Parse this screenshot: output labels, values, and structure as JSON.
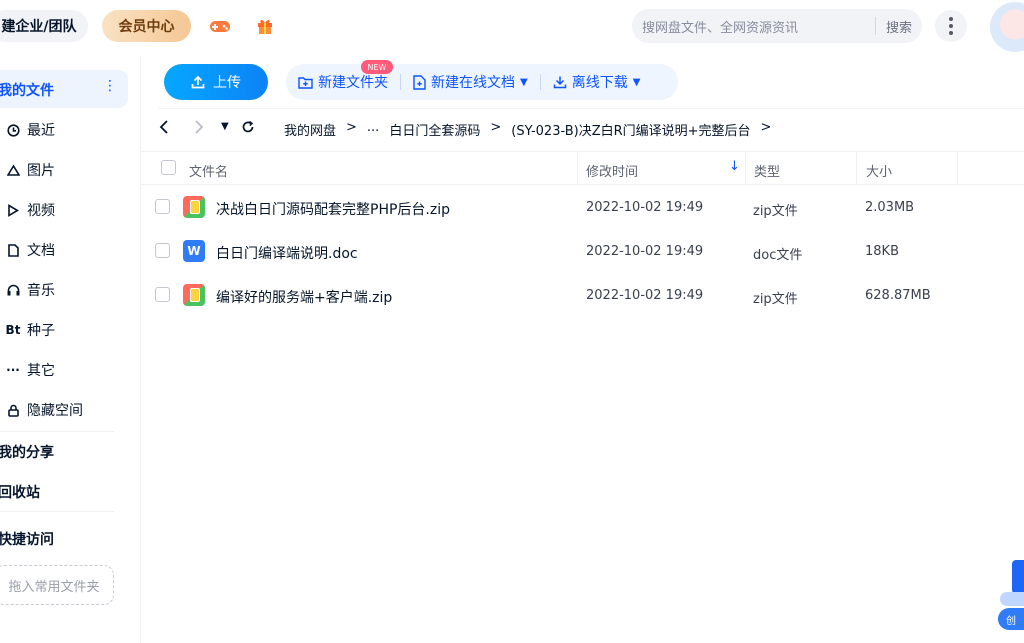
{
  "header": {
    "team_label": "建企业/团队",
    "vip_label": "会员中心",
    "search_placeholder": "搜网盘文件、全网资源资讯",
    "search_button": "搜索",
    "icons": [
      "game-icon",
      "gift-icon",
      "more-icon",
      "avatar"
    ]
  },
  "sidebar": {
    "my_files": "我的文件",
    "items": [
      {
        "icon": "clock-icon",
        "label": "最近"
      },
      {
        "icon": "image-icon",
        "label": "图片"
      },
      {
        "icon": "video-icon",
        "label": "视频"
      },
      {
        "icon": "document-icon",
        "label": "文档"
      },
      {
        "icon": "music-icon",
        "label": "音乐"
      },
      {
        "icon": "torrent-icon",
        "glyph": "Bt",
        "label": "种子"
      },
      {
        "icon": "more-dots-icon",
        "glyph": "···",
        "label": "其它"
      },
      {
        "icon": "lock-icon",
        "label": "隐藏空间"
      }
    ],
    "my_share": "我的分享",
    "recycle_bin": "回收站",
    "quick_access": "快捷访问",
    "drop_hint": "拖入常用文件夹"
  },
  "toolbar": {
    "upload": "上传",
    "new_folder": "新建文件夹",
    "new_online_doc": "新建在线文档",
    "new_badge": "NEW",
    "offline_download": "离线下载"
  },
  "breadcrumb": {
    "root": "我的网盘",
    "ellipsis": "...",
    "level1": "白日门全套源码",
    "level2": "(SY-023-B)决Z白R门编译说明+完整后台"
  },
  "table": {
    "headers": {
      "name": "文件名",
      "modified": "修改时间",
      "type": "类型",
      "size": "大小"
    },
    "rows": [
      {
        "icon": "zip-icon",
        "name": "决战白日门源码配套完整PHP后台.zip",
        "modified": "2022-10-02 19:49",
        "type": "zip文件",
        "size": "2.03MB"
      },
      {
        "icon": "doc-icon",
        "icon_glyph": "W",
        "name": "白日门编译端说明.doc",
        "modified": "2022-10-02 19:49",
        "type": "doc文件",
        "size": "18KB"
      },
      {
        "icon": "zip-icon",
        "name": "编译好的服务端+客户端.zip",
        "modified": "2022-10-02 19:49",
        "type": "zip文件",
        "size": "628.87MB"
      }
    ]
  },
  "assistant": {
    "tag": "创"
  }
}
